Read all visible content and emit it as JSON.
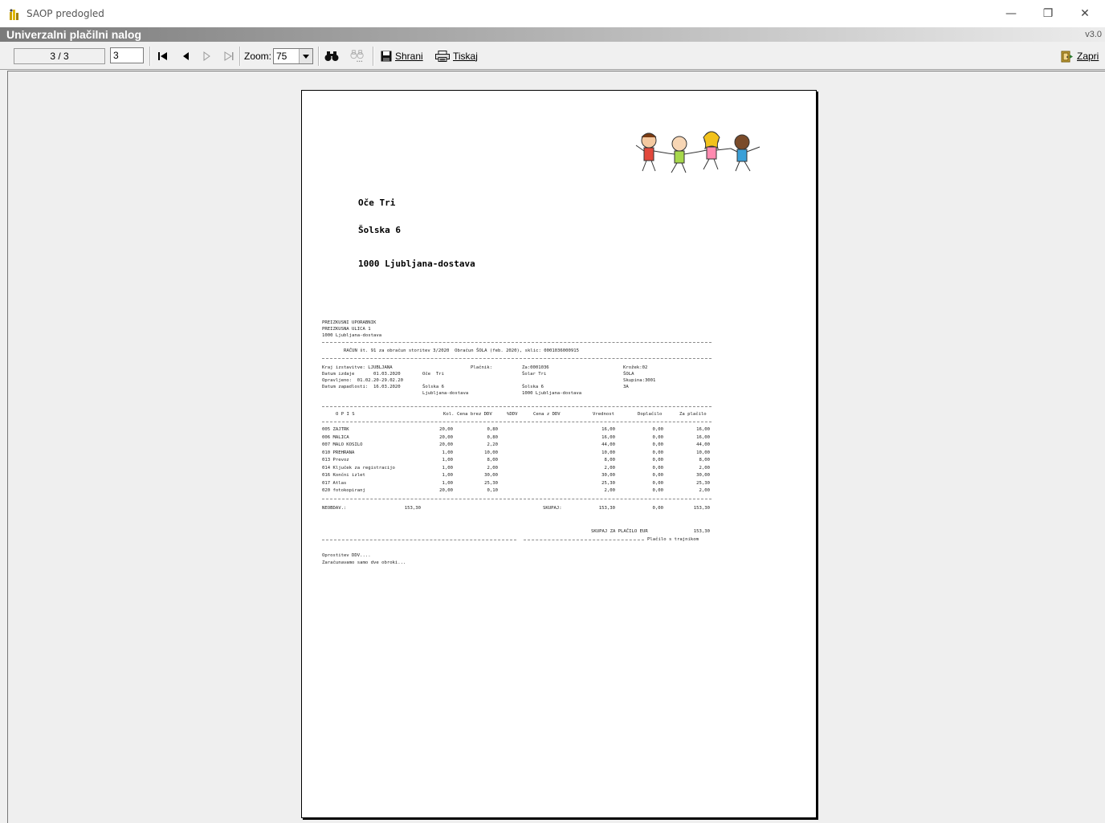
{
  "window": {
    "title": "SAOP predogled",
    "minimize": "—",
    "restore": "❐",
    "close": "✕"
  },
  "subbar": {
    "title": "Univerzalni plačilni nalog",
    "version": "v3.0"
  },
  "toolbar": {
    "page_indicator": "3 / 3",
    "page_input": "3",
    "zoom_label": "Zoom:",
    "zoom_value": "75",
    "save_label": "Shrani",
    "print_label": "Tiskaj",
    "close_label": "Zapri"
  },
  "document": {
    "recipient": {
      "name": "Oče  Tri",
      "street": "Šolska 6",
      "city": "1000 Ljubljana-dostava"
    },
    "issuer": [
      "PREIZKUSNI UPORABNIK",
      "PREIZKUSNA ULICA 1",
      "1000 Ljubljana-dostava"
    ],
    "invoice_line": "RAČUN št. 91 za obračun storitev 3/2020  Obračun ŠOLA (feb. 2020), sklic: 0001036000915",
    "meta": {
      "place": "Kraj izstavitve: LJUBLJANA",
      "payer_label": "Plačnik:",
      "za": "Za:0001036",
      "kroz": "Krožek:02",
      "issue_date": "Datum izdaje       01.03.2020",
      "payer_name": "Oče  Tri",
      "student": "Šolar Tri",
      "school": "ŠOLA",
      "performed": "Opravljeno:  01.02.20-29.02.20",
      "group": "Skupina:3001",
      "due_date": "Datum zapadlosti:  16.03.2020",
      "payer_street": "Šolska 6",
      "student_street": "Šolska 6",
      "class": "3A",
      "payer_city": "Ljubljana-dostava",
      "student_city": "1000 Ljubljana-dostava"
    },
    "columns": [
      "O P I S",
      "Kol.",
      "Cena brez DDV",
      "%DDV",
      "Cena z DDV",
      "Vrednost",
      "Doplačilo",
      "Za plačilo"
    ],
    "rows": [
      [
        "005 ZAJTRK",
        "20,00",
        "0,80",
        "16,00",
        "0,00",
        "16,00"
      ],
      [
        "006 MALICA",
        "20,00",
        "0,80",
        "16,00",
        "0,00",
        "16,00"
      ],
      [
        "007 MALO KOSILO",
        "20,00",
        "2,20",
        "44,00",
        "0,00",
        "44,00"
      ],
      [
        "010 PREHRANA",
        "1,00",
        "10,00",
        "10,00",
        "0,00",
        "10,00"
      ],
      [
        "013 Prevoz",
        "1,00",
        "8,00",
        "8,00",
        "0,00",
        "8,00"
      ],
      [
        "014 Ključek za registracijo",
        "1,00",
        "2,00",
        "2,00",
        "0,00",
        "2,00"
      ],
      [
        "016 Končni izlet",
        "1,00",
        "30,00",
        "30,00",
        "0,00",
        "30,00"
      ],
      [
        "017 Atlas",
        "1,00",
        "25,30",
        "25,30",
        "0,00",
        "25,30"
      ],
      [
        "020 fotokopiranj",
        "20,00",
        "0,10",
        "2,00",
        "0,00",
        "2,00"
      ]
    ],
    "totals": {
      "label_left": "NEOBDAV.:",
      "value_left": "153,30",
      "label_right": "SKUPAJ:",
      "vrednost": "153,30",
      "doplacilo": "0,00",
      "za_placilo": "153,30"
    },
    "grand_total": {
      "label": "SKUPAJ ZA PLAČILO EUR",
      "value": "153,30"
    },
    "payment_note": "Plačilo s trajnikom",
    "notes": [
      "Oprostitev DDV....",
      "Zaračunavamo samo dve obroki..."
    ]
  }
}
